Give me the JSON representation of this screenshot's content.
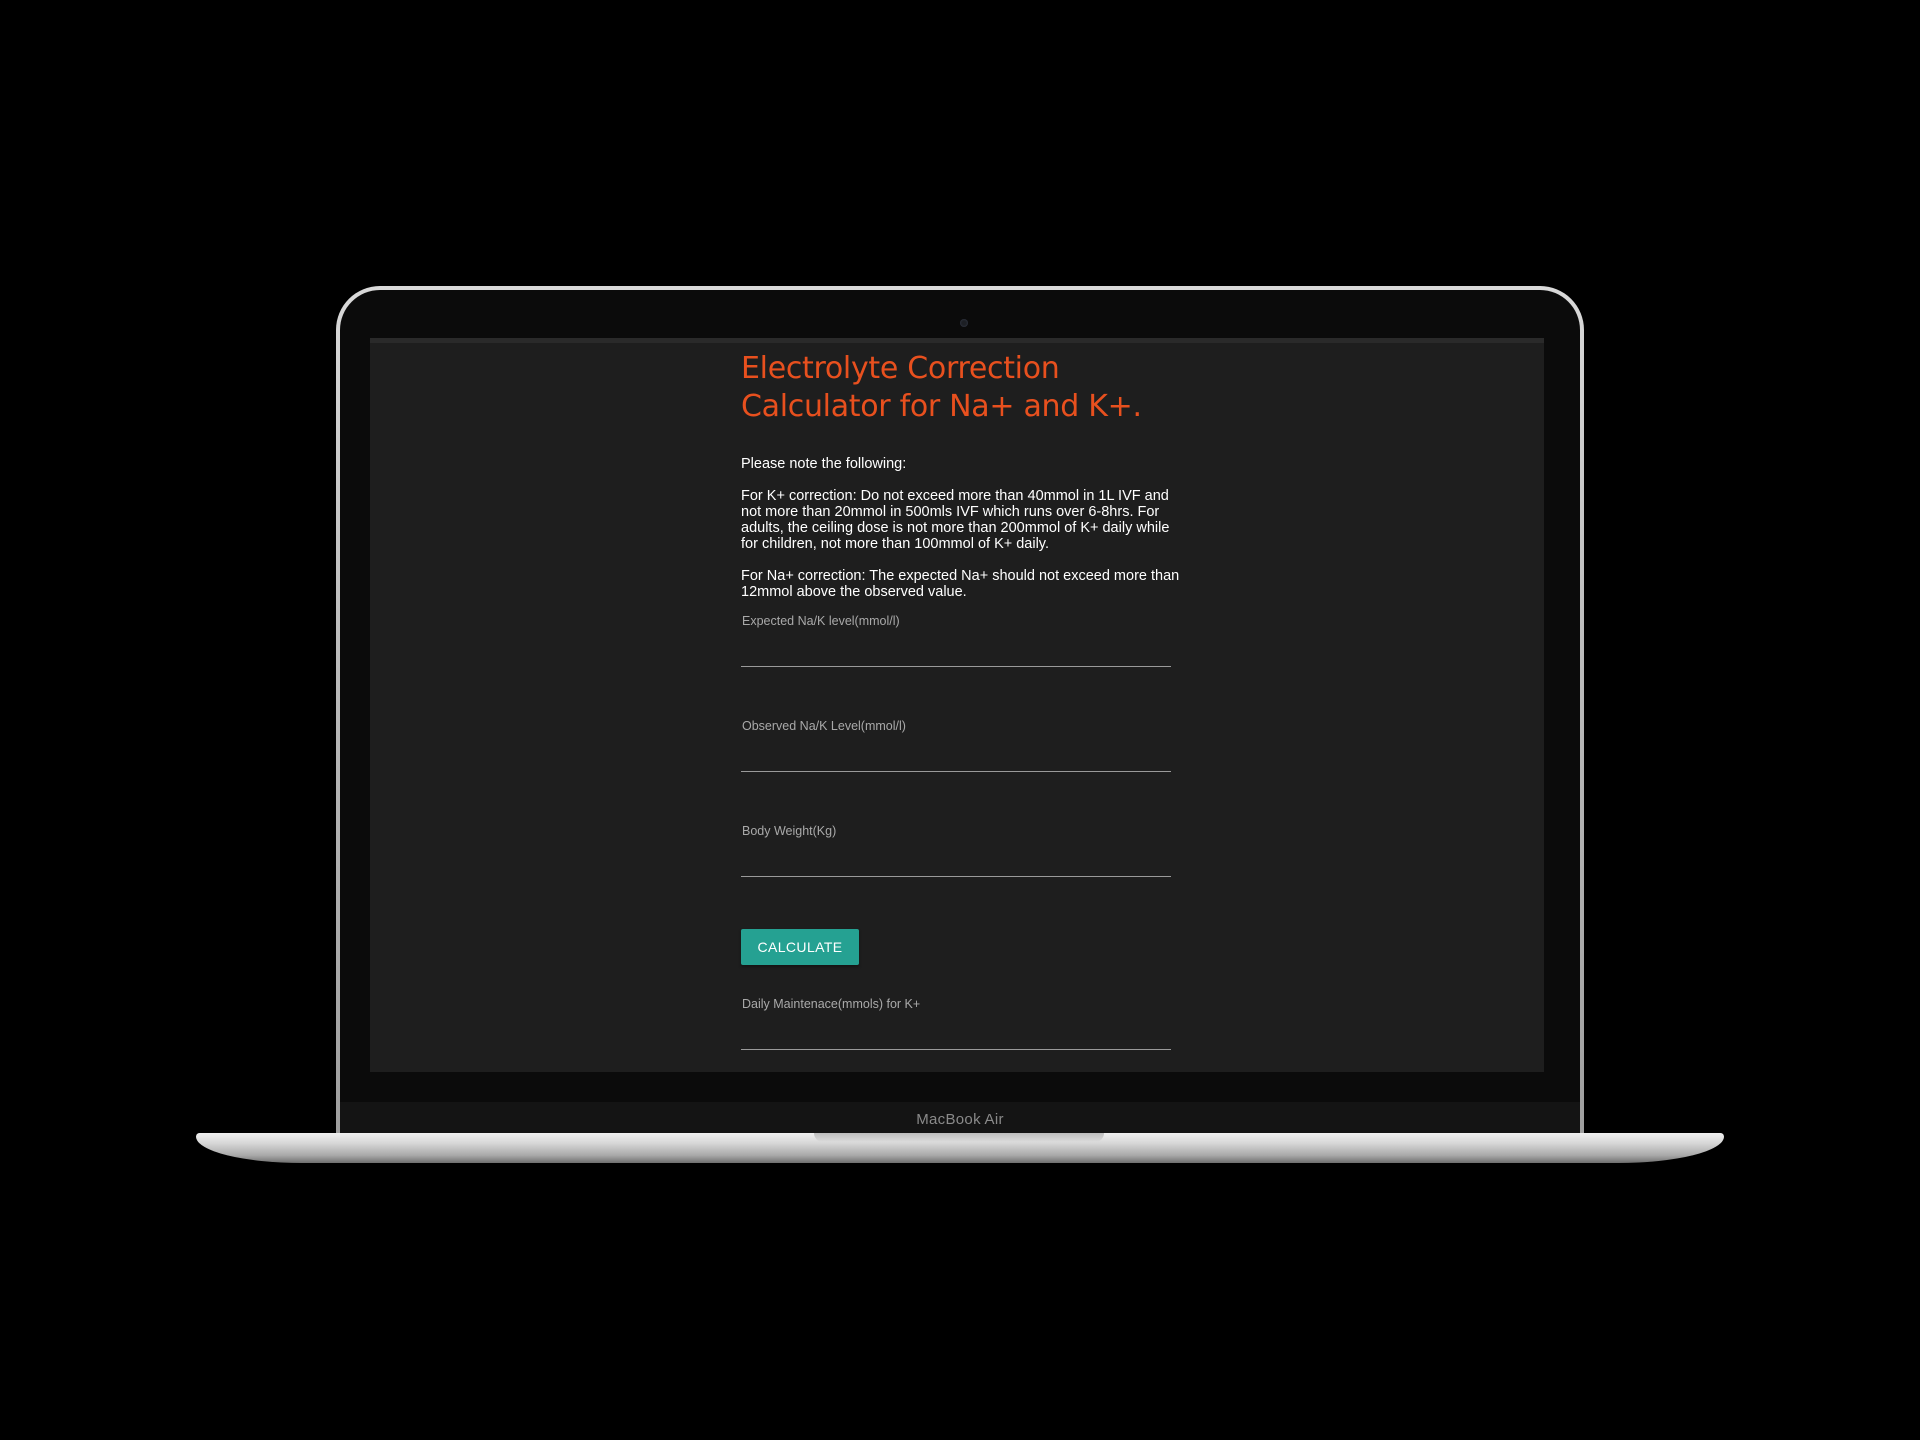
{
  "device": {
    "brand": "MacBook Air"
  },
  "app": {
    "title": "Electrolyte Correction Calculator for Na+ and K+.",
    "intro": "Please note the following:",
    "notes": [
      "For K+ correction: Do not exceed more than 40mmol in 1L IVF and not more than 20mmol in 500mls IVF which runs over 6-8hrs. For adults, the ceiling dose is not more than 200mmol of K+ daily while for children, not more than 100mmol of K+ daily.",
      "For Na+ correction: The expected Na+ should not exceed more than 12mmol above the observed value."
    ],
    "fields": {
      "expected": {
        "label": "Expected Na/K level(mmol/l)",
        "value": ""
      },
      "observed": {
        "label": "Observed Na/K Level(mmol/l)",
        "value": ""
      },
      "weight": {
        "label": "Body Weight(Kg)",
        "value": ""
      },
      "maintenance": {
        "label": "Daily Maintenace(mmols) for K+",
        "value": ""
      }
    },
    "calculate_label": "CALCULATE"
  },
  "colors": {
    "title": "#e8501e",
    "button": "#25a192",
    "screen_background": "#1e1e1e"
  }
}
